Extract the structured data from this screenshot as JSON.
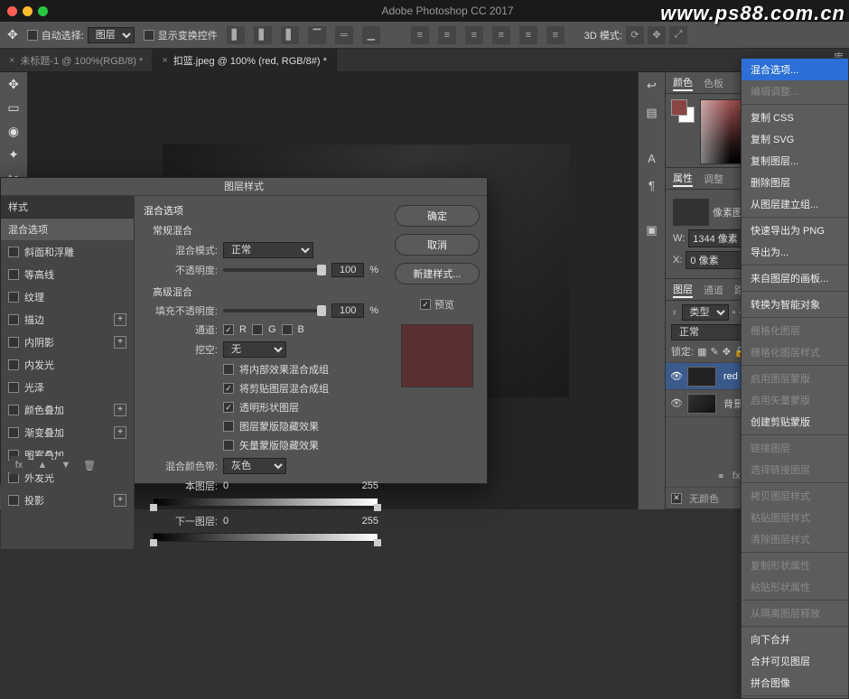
{
  "watermark": "www.ps88.com.cn",
  "app": {
    "title": "Adobe Photoshop CC 2017"
  },
  "options": {
    "auto_select": "自动选择:",
    "mode": "图层",
    "show_transform": "显示变换控件",
    "mode3d": "3D 模式:"
  },
  "tabs": {
    "tab1": "未标题-1 @ 100%(RGB/8) *",
    "tab2": "扣篮.jpeg @ 100% (red, RGB/8#) *",
    "close": "×"
  },
  "panels": {
    "color": {
      "tab_color": "颜色",
      "tab_swatch": "色板",
      "tab_lib": "库"
    },
    "props": {
      "tab_props": "属性",
      "tab_adjust": "调整",
      "doc_props": "像素图层属性",
      "w_lbl": "W:",
      "w_val": "1344 像素",
      "x_lbl": "X:",
      "x_val": "0 像素"
    },
    "layers": {
      "tab_layers": "图层",
      "tab_channels": "通道",
      "tab_paths": "路径",
      "kind_lbl": "类型",
      "blend_mode": "正常",
      "lock_lbl": "锁定:",
      "layer1": "red",
      "layer2": "背景",
      "no_color": "无颜色"
    }
  },
  "context": {
    "items": [
      {
        "label": "混合选项...",
        "kind": "highlight"
      },
      {
        "label": "编辑调整...",
        "kind": "faded"
      },
      {
        "kind": "sep"
      },
      {
        "label": "复制 CSS",
        "kind": ""
      },
      {
        "label": "复制 SVG",
        "kind": ""
      },
      {
        "label": "复制图层...",
        "kind": ""
      },
      {
        "label": "删除图层",
        "kind": ""
      },
      {
        "label": "从图层建立组...",
        "kind": ""
      },
      {
        "kind": "sep"
      },
      {
        "label": "快速导出为 PNG",
        "kind": ""
      },
      {
        "label": "导出为...",
        "kind": ""
      },
      {
        "kind": "sep"
      },
      {
        "label": "来自图层的画板...",
        "kind": ""
      },
      {
        "kind": "sep"
      },
      {
        "label": "转换为智能对象",
        "kind": ""
      },
      {
        "kind": "sep"
      },
      {
        "label": "栅格化图层",
        "kind": "faded"
      },
      {
        "label": "栅格化图层样式",
        "kind": "faded"
      },
      {
        "kind": "sep"
      },
      {
        "label": "启用图层蒙版",
        "kind": "faded"
      },
      {
        "label": "启用矢量蒙版",
        "kind": "faded"
      },
      {
        "label": "创建剪贴蒙版",
        "kind": ""
      },
      {
        "kind": "sep"
      },
      {
        "label": "链接图层",
        "kind": "faded"
      },
      {
        "label": "选择链接图层",
        "kind": "faded"
      },
      {
        "kind": "sep"
      },
      {
        "label": "拷贝图层样式",
        "kind": "faded"
      },
      {
        "label": "粘贴图层样式",
        "kind": "faded"
      },
      {
        "label": "清除图层样式",
        "kind": "faded"
      },
      {
        "kind": "sep"
      },
      {
        "label": "复制形状属性",
        "kind": "faded"
      },
      {
        "label": "粘贴形状属性",
        "kind": "faded"
      },
      {
        "kind": "sep"
      },
      {
        "label": "从隔离图层释放",
        "kind": "faded"
      },
      {
        "kind": "sep"
      },
      {
        "label": "向下合并",
        "kind": ""
      },
      {
        "label": "合并可见图层",
        "kind": ""
      },
      {
        "label": "拼合图像",
        "kind": ""
      },
      {
        "kind": "sep"
      }
    ]
  },
  "layer_style": {
    "title": "图层样式",
    "sidebar_hdr": "样式",
    "styles": [
      {
        "label": "混合选项",
        "active": true,
        "add": false
      },
      {
        "label": "斜面和浮雕",
        "add": false,
        "chk": true
      },
      {
        "label": "等高线",
        "add": false,
        "chk": true
      },
      {
        "label": "纹理",
        "add": false,
        "chk": true
      },
      {
        "label": "描边",
        "add": true,
        "chk": true
      },
      {
        "label": "内阴影",
        "add": true,
        "chk": true
      },
      {
        "label": "内发光",
        "add": false,
        "chk": true
      },
      {
        "label": "光泽",
        "add": false,
        "chk": true
      },
      {
        "label": "颜色叠加",
        "add": true,
        "chk": true
      },
      {
        "label": "渐变叠加",
        "add": true,
        "chk": true
      },
      {
        "label": "图案叠加",
        "add": false,
        "chk": true
      },
      {
        "label": "外发光",
        "add": false,
        "chk": true
      },
      {
        "label": "投影",
        "add": true,
        "chk": true
      }
    ],
    "section_blend": "混合选项",
    "sub_normal": "常规混合",
    "blend_mode_lbl": "混合模式:",
    "blend_mode_val": "正常",
    "opacity_lbl": "不透明度:",
    "opacity_val": "100",
    "pct": "%",
    "sub_adv": "高级混合",
    "fill_lbl": "填充不透明度:",
    "fill_val": "100",
    "channels_lbl": "通道:",
    "ch_r": "R",
    "ch_g": "G",
    "ch_b": "B",
    "knockout_lbl": "挖空:",
    "knockout_val": "无",
    "cb1": "将内部效果混合成组",
    "cb2": "将剪贴图层混合成组",
    "cb3": "透明形状图层",
    "cb4": "图层蒙版隐藏效果",
    "cb5": "矢量蒙版隐藏效果",
    "blendif_lbl": "混合颜色带:",
    "blendif_val": "灰色",
    "this_layer": "本图层:",
    "v0": "0",
    "v255": "255",
    "under_layer": "下一图层:",
    "btn_ok": "确定",
    "btn_cancel": "取消",
    "btn_new": "新建样式...",
    "preview_lbl": "预览"
  }
}
